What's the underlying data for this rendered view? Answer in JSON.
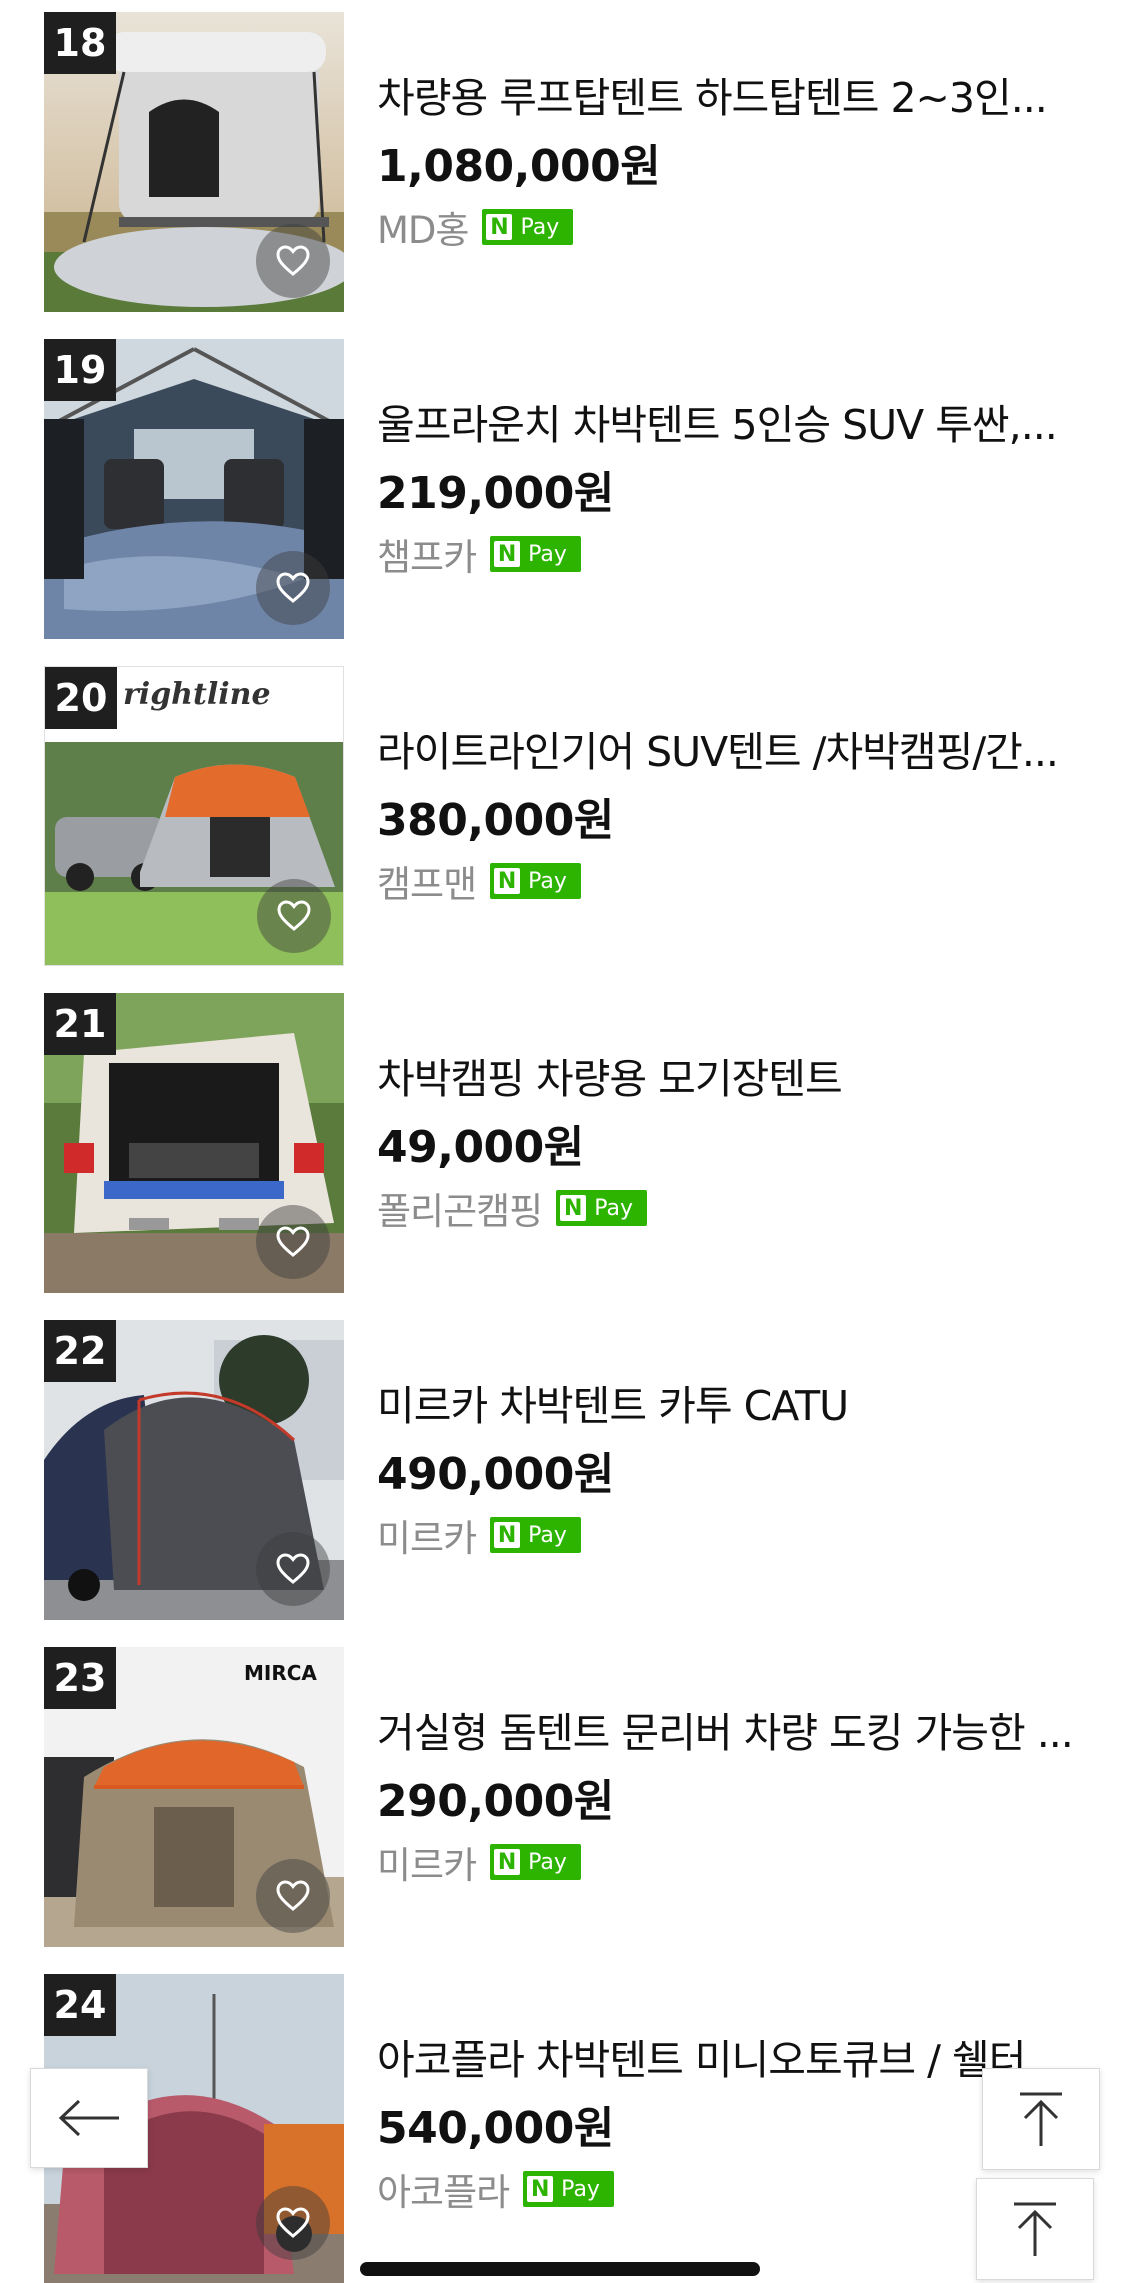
{
  "items": [
    {
      "rank": "18",
      "title": "차량용 루프탑텐트 하드탑텐트 2~3인...",
      "price": "1,080,000원",
      "seller": "MD홍",
      "pay_label": "Pay",
      "pay_n": "N"
    },
    {
      "rank": "19",
      "title": "울프라운치 차박텐트 5인승 SUV 투싼,...",
      "price": "219,000원",
      "seller": "챔프카",
      "pay_label": "Pay",
      "pay_n": "N"
    },
    {
      "rank": "20",
      "title": "라이트라인기어 SUV텐트 /차박캠핑/간...",
      "price": "380,000원",
      "seller": "캠프맨",
      "pay_label": "Pay",
      "pay_n": "N",
      "image_text": "rightline"
    },
    {
      "rank": "21",
      "title": "차박캠핑 차량용 모기장텐트",
      "price": "49,000원",
      "seller": "폴리곤캠핑",
      "pay_label": "Pay",
      "pay_n": "N"
    },
    {
      "rank": "22",
      "title": "미르카 차박텐트 카투 CATU",
      "price": "490,000원",
      "seller": "미르카",
      "pay_label": "Pay",
      "pay_n": "N"
    },
    {
      "rank": "23",
      "title": "거실형 돔텐트 문리버 차량 도킹 가능한 ...",
      "price": "290,000원",
      "seller": "미르카",
      "pay_label": "Pay",
      "pay_n": "N",
      "image_text": "MIRCA"
    },
    {
      "rank": "24",
      "title": "아코플라 차박텐트 미니오토큐브 / 쉘터",
      "price": "540,000원",
      "seller": "아코플라",
      "pay_label": "Pay",
      "pay_n": "N"
    }
  ],
  "icons": {
    "back": "arrow-left-icon",
    "top": "arrow-to-top-icon",
    "wish": "heart-icon"
  },
  "colors": {
    "npay": "#2db400",
    "rank_bg": "#1f1f1f"
  }
}
